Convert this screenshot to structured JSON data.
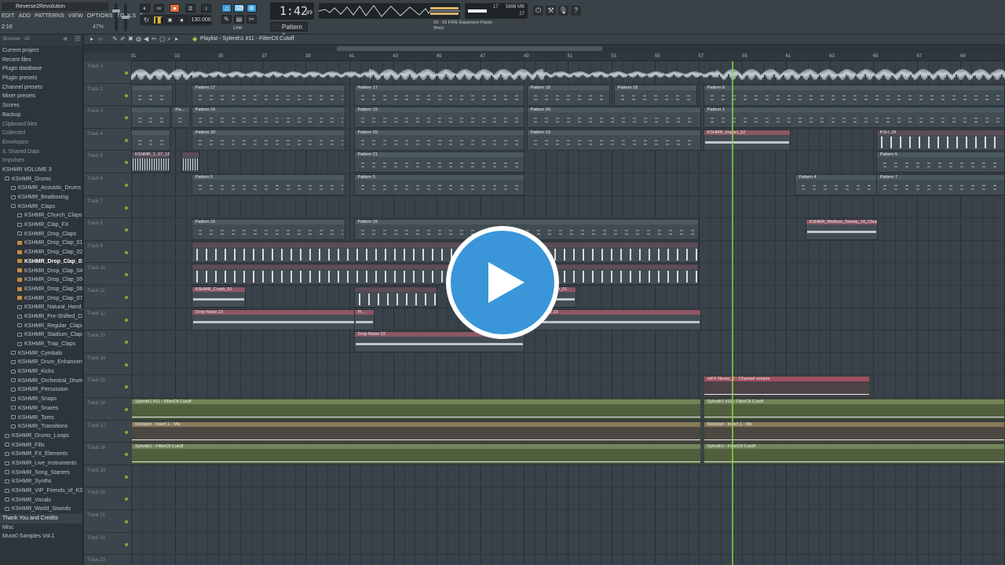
{
  "window": {
    "title": "Reverse2Revolution"
  },
  "menu": [
    "EDIT",
    "ADD",
    "PATTERNS",
    "VIEW",
    "OPTIONS",
    "TOOLS",
    "?"
  ],
  "hint_left": "2:16",
  "zoom_pct": "47%",
  "transport": {
    "bpm": "130.000",
    "time": "1:42",
    "time_small": "49",
    "pattern": "Pattern 8",
    "snap": "Line"
  },
  "cpu": {
    "voices": "17",
    "mem": "5898 MB",
    "poly": "27"
  },
  "news": {
    "line1": "03 · 03   FIRE Expansion Packs",
    "line2": "(free)"
  },
  "browser": {
    "header": "Browser · All",
    "items": [
      {
        "label": "Current project",
        "level": 0
      },
      {
        "label": "Recent files",
        "level": 0
      },
      {
        "label": "Plugin database",
        "level": 0
      },
      {
        "label": "Plugin presets",
        "level": 0
      },
      {
        "label": "Channel presets",
        "level": 0
      },
      {
        "label": "Mixer presets",
        "level": 0
      },
      {
        "label": "Scores",
        "level": 0
      },
      {
        "label": "Backup",
        "level": 0
      },
      {
        "label": "Clipboard files",
        "level": 0
      },
      {
        "label": "Collected",
        "level": 0
      },
      {
        "label": "Envelopes",
        "level": 0
      },
      {
        "label": "IL Shared Data",
        "level": 0
      },
      {
        "label": "Impulses",
        "level": 0
      },
      {
        "label": "KSHMR VOLUME 3",
        "level": 0
      },
      {
        "label": "KSHMR_Drums",
        "level": 1
      },
      {
        "label": "KSHMR_Acoustic_Drums",
        "level": 2
      },
      {
        "label": "KSHMR_Beatboxing",
        "level": 2
      },
      {
        "label": "KSHMR_Claps",
        "level": 2
      },
      {
        "label": "KSHMR_Church_Claps",
        "level": 3
      },
      {
        "label": "KSHMR_Clap_FX",
        "level": 3
      },
      {
        "label": "KSHMR_Drop_Claps",
        "level": 3
      },
      {
        "label": "KSHMR_Drop_Clap_01_126",
        "level": 3
      },
      {
        "label": "KSHMR_Drop_Clap_02_128",
        "level": 3
      },
      {
        "label": "KSHMR_Drop_Clap_03_128",
        "level": 3
      },
      {
        "label": "KSHMR_Drop_Clap_04_128",
        "level": 3
      },
      {
        "label": "KSHMR_Drop_Clap_05_128",
        "level": 3
      },
      {
        "label": "KSHMR_Drop_Clap_06_128",
        "level": 3
      },
      {
        "label": "KSHMR_Drop_Clap_07_125",
        "level": 3
      },
      {
        "label": "KSHMR_Natural_Hand_Claps",
        "level": 3
      },
      {
        "label": "KSHMR_Pre-Shifted_Claps",
        "level": 3
      },
      {
        "label": "KSHMR_Regular_Claps",
        "level": 3
      },
      {
        "label": "KSHMR_Stadium_Claps",
        "level": 3
      },
      {
        "label": "KSHMR_Trap_Claps",
        "level": 3
      },
      {
        "label": "KSHMR_Cymbals",
        "level": 2
      },
      {
        "label": "KSHMR_Drum_Enhancers",
        "level": 2
      },
      {
        "label": "KSHMR_Kicks",
        "level": 2
      },
      {
        "label": "KSHMR_Orchestral_Drums",
        "level": 2
      },
      {
        "label": "KSHMR_Percussion",
        "level": 2
      },
      {
        "label": "KSHMR_Snaps",
        "level": 2
      },
      {
        "label": "KSHMR_Snares",
        "level": 2
      },
      {
        "label": "KSHMR_Toms",
        "level": 2
      },
      {
        "label": "KSHMR_Transitions",
        "level": 2
      },
      {
        "label": "KSHMR_Drums_Loops",
        "level": 1
      },
      {
        "label": "KSHMR_Fills",
        "level": 1
      },
      {
        "label": "KSHMR_FX_Elements",
        "level": 1
      },
      {
        "label": "KSHMR_Live_Instruments",
        "level": 1
      },
      {
        "label": "KSHMR_Song_Starters",
        "level": 1
      },
      {
        "label": "KSHMR_Synths",
        "level": 1
      },
      {
        "label": "KSHMR_VIP_Friends_of_KSHMR",
        "level": 1
      },
      {
        "label": "KSHMR_Vocals",
        "level": 1
      },
      {
        "label": "KSHMR_World_Sounds",
        "level": 1
      },
      {
        "label": "Thank You and Credits",
        "level": 0
      },
      {
        "label": "Misc",
        "level": 0
      },
      {
        "label": "Mura0 Samples Vol.1",
        "level": 0
      }
    ],
    "selected": "KSHMR_Drop_Clap_03_128",
    "highlighted": "Thank You and Credits"
  },
  "playlist": {
    "title": "Playlist - Sylenth1 #11 - FilterCtl Cutoff",
    "ruler": [
      "31",
      "33",
      "35",
      "37",
      "39",
      "41",
      "43",
      "45",
      "47",
      "49",
      "51",
      "53",
      "55",
      "57",
      "59",
      "61",
      "63",
      "65",
      "67",
      "69"
    ],
    "tracks": [
      "Track 1",
      "Track 2",
      "Track 3",
      "Track 4",
      "Track 5",
      "Track 6",
      "Track 7",
      "Track 8",
      "Track 9",
      "Track 10",
      "Track 11",
      "Track 12",
      "Track 13",
      "Track 14",
      "Track 15",
      "Track 16",
      "Track 17",
      "Track 18",
      "Track 19",
      "Track 20",
      "Track 21",
      "Track 22",
      "Track 23"
    ],
    "clips": [
      {
        "lane": 1,
        "start": 0.0,
        "len": 1.0,
        "type": "pattern",
        "label": ""
      },
      {
        "lane": 1,
        "start": 1.45,
        "len": 3.7,
        "type": "pattern",
        "label": "Pattern 17"
      },
      {
        "lane": 1,
        "start": 5.35,
        "len": 4.1,
        "type": "pattern",
        "label": "Pattern 17"
      },
      {
        "lane": 1,
        "start": 9.5,
        "len": 2.0,
        "type": "pattern",
        "label": "Pattern 18"
      },
      {
        "lane": 1,
        "start": 11.6,
        "len": 2.0,
        "type": "pattern",
        "label": "Pattern 18"
      },
      {
        "lane": 1,
        "start": 13.75,
        "len": 7.25,
        "type": "pattern",
        "label": "Pattern 8"
      },
      {
        "lane": 2,
        "start": 0.0,
        "len": 0.95,
        "type": "pattern",
        "label": ""
      },
      {
        "lane": 2,
        "start": 0.97,
        "len": 0.45,
        "type": "pattern",
        "label": "Pa..."
      },
      {
        "lane": 2,
        "start": 1.45,
        "len": 3.7,
        "type": "pattern",
        "label": "Pattern 15"
      },
      {
        "lane": 2,
        "start": 5.35,
        "len": 4.1,
        "type": "pattern",
        "label": "Pattern 15"
      },
      {
        "lane": 2,
        "start": 9.5,
        "len": 4.2,
        "type": "pattern",
        "label": "Pattern 20"
      },
      {
        "lane": 2,
        "start": 13.75,
        "len": 7.25,
        "type": "pattern",
        "label": "Pattern 1"
      },
      {
        "lane": 3,
        "start": 0.0,
        "len": 0.95,
        "type": "pattern",
        "label": ""
      },
      {
        "lane": 3,
        "start": 1.45,
        "len": 3.7,
        "type": "pattern",
        "label": "Pattern 20"
      },
      {
        "lane": 3,
        "start": 5.35,
        "len": 4.1,
        "type": "pattern",
        "label": "Pattern 20"
      },
      {
        "lane": 3,
        "start": 9.5,
        "len": 4.2,
        "type": "pattern",
        "label": "Pattern 19"
      },
      {
        "lane": 3,
        "start": 13.75,
        "len": 2.1,
        "type": "noise",
        "label": "KSHMR_Impact_02"
      },
      {
        "lane": 3,
        "start": 17.9,
        "len": 3.1,
        "type": "spikes",
        "label": "KSH..28"
      },
      {
        "lane": 4,
        "start": 0.0,
        "len": 0.95,
        "type": "audio",
        "label": "KSHMR_1_07_128"
      },
      {
        "lane": 4,
        "start": 1.2,
        "len": 0.45,
        "type": "audio",
        "label": ""
      },
      {
        "lane": 4,
        "start": 5.35,
        "len": 4.1,
        "type": "pattern",
        "label": "Pattern 21"
      },
      {
        "lane": 4,
        "start": 17.9,
        "len": 3.1,
        "type": "pattern",
        "label": "Pattern 5"
      },
      {
        "lane": 5,
        "start": 1.45,
        "len": 3.7,
        "type": "pattern",
        "label": "Pattern 5"
      },
      {
        "lane": 5,
        "start": 5.35,
        "len": 4.1,
        "type": "pattern",
        "label": "Pattern 5"
      },
      {
        "lane": 5,
        "start": 15.95,
        "len": 2.0,
        "type": "pattern",
        "label": "Pattern 4"
      },
      {
        "lane": 5,
        "start": 17.9,
        "len": 3.1,
        "type": "pattern",
        "label": "Pattern 7"
      },
      {
        "lane": 7,
        "start": 1.45,
        "len": 3.7,
        "type": "pattern",
        "label": "Pattern 16"
      },
      {
        "lane": 7,
        "start": 5.35,
        "len": 8.3,
        "type": "pattern",
        "label": "Pattern 16"
      },
      {
        "lane": 7,
        "start": 16.2,
        "len": 1.75,
        "type": "noise",
        "label": "KSHMR_Medium_Sweep_16_Clean"
      },
      {
        "lane": 8,
        "start": 1.45,
        "len": 12.2,
        "type": "spikes",
        "label": ""
      },
      {
        "lane": 9,
        "start": 1.45,
        "len": 12.2,
        "type": "spikes",
        "label": ""
      },
      {
        "lane": 10,
        "start": 1.45,
        "len": 1.3,
        "type": "noise",
        "label": "KSHMR_Crash_01"
      },
      {
        "lane": 10,
        "start": 5.35,
        "len": 2.0,
        "type": "spikes",
        "label": ""
      },
      {
        "lane": 10,
        "start": 9.5,
        "len": 1.2,
        "type": "noise",
        "label": "KSHMR_Crash_01"
      },
      {
        "lane": 11,
        "start": 1.45,
        "len": 4.0,
        "type": "noise",
        "label": "Drop Noise 23"
      },
      {
        "lane": 11,
        "start": 5.35,
        "len": 0.5,
        "type": "noise",
        "label": "Pl..."
      },
      {
        "lane": 11,
        "start": 9.5,
        "len": 4.2,
        "type": "noise",
        "label": "Drop Noise 23"
      },
      {
        "lane": 12,
        "start": 5.35,
        "len": 4.1,
        "type": "noise",
        "label": "Drop Noise 23"
      },
      {
        "lane": 14,
        "start": 13.75,
        "len": 4.0,
        "type": "autopink",
        "label": "reFX Nexus_2 - Channel volume"
      },
      {
        "lane": 15,
        "start": 0.0,
        "len": 13.7,
        "type": "auto",
        "label": "Sylenth1 #11 - FilterCtl Cutoff"
      },
      {
        "lane": 15,
        "start": 13.75,
        "len": 7.25,
        "type": "auto",
        "label": "Sylenth1 #11 - FilterCtl Cutoff"
      },
      {
        "lane": 16,
        "start": 0.0,
        "len": 13.7,
        "type": "autotan",
        "label": "Kickstart - Insert 1 - Mix"
      },
      {
        "lane": 16,
        "start": 13.75,
        "len": 7.25,
        "type": "autotan",
        "label": "Kickstart - Insert 1 - Mix"
      },
      {
        "lane": 17,
        "start": 0.0,
        "len": 13.7,
        "type": "auto",
        "label": "Sylenth1 - FilterCtl Cutoff"
      },
      {
        "lane": 17,
        "start": 13.75,
        "len": 7.25,
        "type": "auto",
        "label": "Sylenth1 - FilterCtl Cutoff"
      }
    ]
  },
  "colors": {
    "accent": "#3a96d8",
    "playhead": "#8ed83a",
    "orange": "#e06c3a"
  },
  "overlay": {
    "icon": "play-icon"
  }
}
